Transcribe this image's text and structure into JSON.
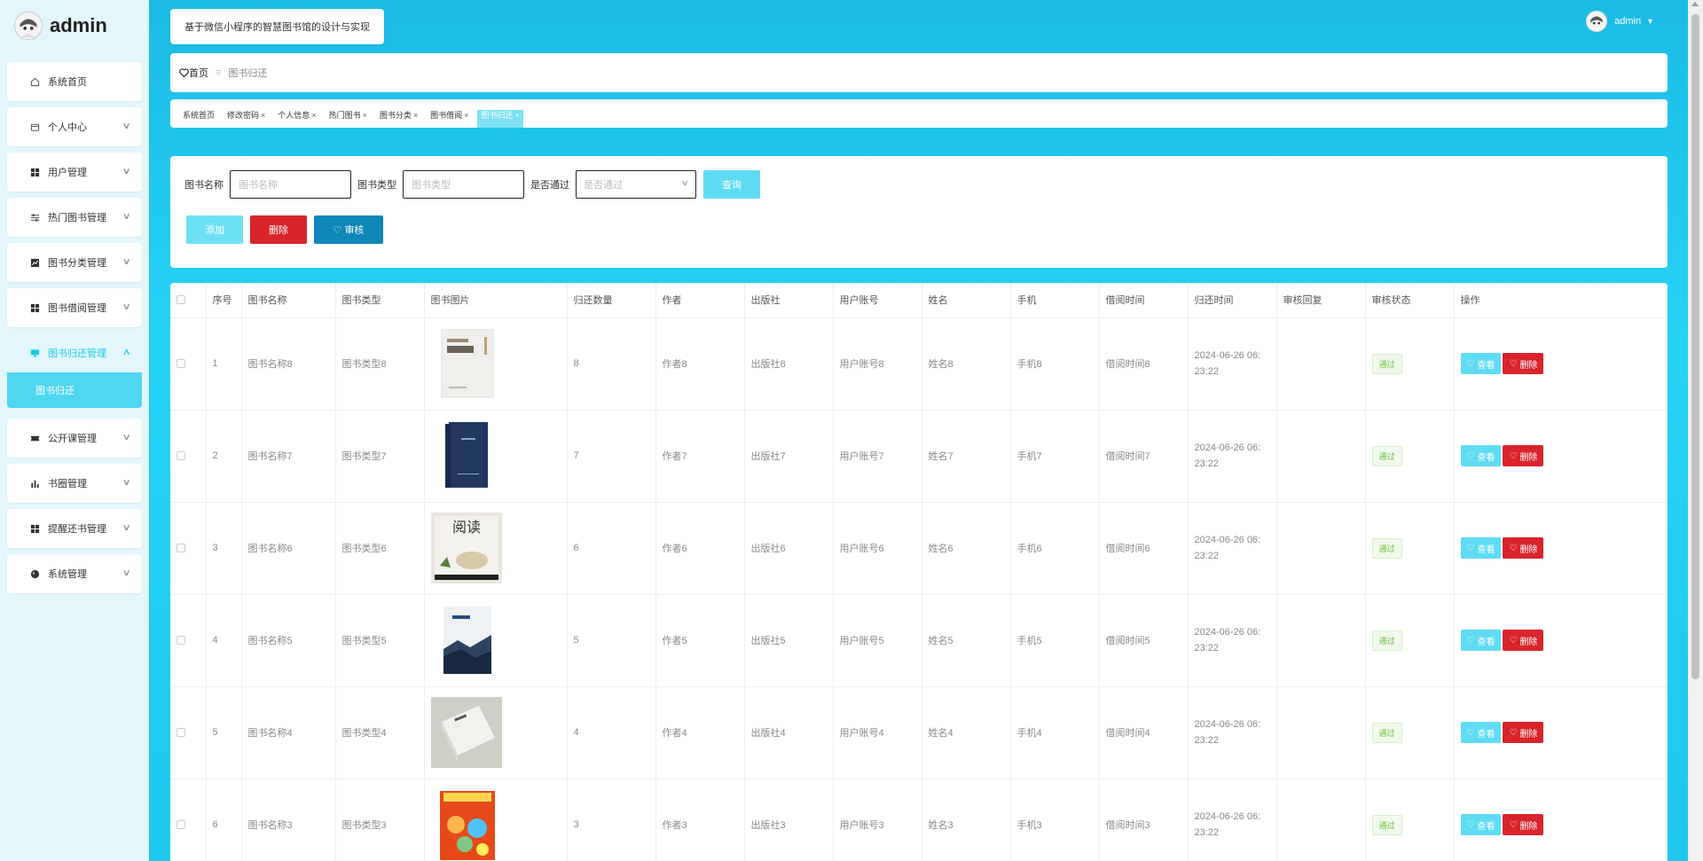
{
  "sidebar": {
    "brand": "admin",
    "items": [
      {
        "label": "系统首页",
        "icon": "home-icon",
        "arrow": false
      },
      {
        "label": "个人中心",
        "icon": "wallet-icon",
        "arrow": true
      },
      {
        "label": "用户管理",
        "icon": "grid-icon",
        "arrow": true
      },
      {
        "label": "热门图书管理",
        "icon": "sliders-icon",
        "arrow": true
      },
      {
        "label": "图书分类管理",
        "icon": "chart-icon",
        "arrow": true
      },
      {
        "label": "图书借阅管理",
        "icon": "grid-icon",
        "arrow": true
      },
      {
        "label": "图书归还管理",
        "icon": "monitor-icon",
        "arrow": true,
        "active": true
      },
      {
        "label": "公开课管理",
        "icon": "ticket-icon",
        "arrow": true
      },
      {
        "label": "书圈管理",
        "icon": "bar-chart-icon",
        "arrow": true
      },
      {
        "label": "提醒还书管理",
        "icon": "grid-icon",
        "arrow": true
      },
      {
        "label": "系统管理",
        "icon": "globe-icon",
        "arrow": true
      }
    ],
    "submenu": {
      "label": "图书归还"
    }
  },
  "header": {
    "title": "基于微信小程序的智慧图书馆的设计与实现",
    "user": "admin"
  },
  "breadcrumb": {
    "home": "首页",
    "separator": "≡",
    "current": "图书归还"
  },
  "tags": [
    {
      "label": "系统首页",
      "closable": false
    },
    {
      "label": "修改密码",
      "closable": true
    },
    {
      "label": "个人信息",
      "closable": true
    },
    {
      "label": "热门图书",
      "closable": true
    },
    {
      "label": "图书分类",
      "closable": true
    },
    {
      "label": "图书借阅",
      "closable": true
    },
    {
      "label": "图书归还",
      "closable": true,
      "active": true
    }
  ],
  "search": {
    "name_label": "图书名称",
    "name_placeholder": "图书名称",
    "type_label": "图书类型",
    "type_placeholder": "图书类型",
    "pass_label": "是否通过",
    "pass_placeholder": "是否通过",
    "query_button": "查询"
  },
  "actions": {
    "add": "添加",
    "delete": "删除",
    "audit": "审核"
  },
  "table": {
    "columns": [
      "序号",
      "图书名称",
      "图书类型",
      "图书图片",
      "归还数量",
      "作者",
      "出版社",
      "用户账号",
      "姓名",
      "手机",
      "借阅时间",
      "归还时间",
      "审核回复",
      "审核状态",
      "操作"
    ],
    "view_label": "查看",
    "delete_label": "删除",
    "rows": [
      {
        "no": "1",
        "name": "图书名称8",
        "type": "图书类型8",
        "cover": "cover-1",
        "qty": "8",
        "author": "作者8",
        "publisher": "出版社8",
        "account": "用户账号8",
        "realname": "姓名8",
        "phone": "手机8",
        "borrow": "借阅时间8",
        "return1": "2024-06-26 06:",
        "return2": "23:22",
        "reply": "",
        "status": "通过"
      },
      {
        "no": "2",
        "name": "图书名称7",
        "type": "图书类型7",
        "cover": "cover-2",
        "qty": "7",
        "author": "作者7",
        "publisher": "出版社7",
        "account": "用户账号7",
        "realname": "姓名7",
        "phone": "手机7",
        "borrow": "借阅时间7",
        "return1": "2024-06-26 06:",
        "return2": "23:22",
        "reply": "",
        "status": "通过"
      },
      {
        "no": "3",
        "name": "图书名称6",
        "type": "图书类型6",
        "cover": "cover-3",
        "qty": "6",
        "author": "作者6",
        "publisher": "出版社6",
        "account": "用户账号6",
        "realname": "姓名6",
        "phone": "手机6",
        "borrow": "借阅时间6",
        "return1": "2024-06-26 06:",
        "return2": "23:22",
        "reply": "",
        "status": "通过"
      },
      {
        "no": "4",
        "name": "图书名称5",
        "type": "图书类型5",
        "cover": "cover-4",
        "qty": "5",
        "author": "作者5",
        "publisher": "出版社5",
        "account": "用户账号5",
        "realname": "姓名5",
        "phone": "手机5",
        "borrow": "借阅时间5",
        "return1": "2024-06-26 06:",
        "return2": "23:22",
        "reply": "",
        "status": "通过"
      },
      {
        "no": "5",
        "name": "图书名称4",
        "type": "图书类型4",
        "cover": "cover-5",
        "qty": "4",
        "author": "作者4",
        "publisher": "出版社4",
        "account": "用户账号4",
        "realname": "姓名4",
        "phone": "手机4",
        "borrow": "借阅时间4",
        "return1": "2024-06-26 06:",
        "return2": "23:22",
        "reply": "",
        "status": "通过"
      },
      {
        "no": "6",
        "name": "图书名称3",
        "type": "图书类型3",
        "cover": "cover-6",
        "qty": "3",
        "author": "作者3",
        "publisher": "出版社3",
        "account": "用户账号3",
        "realname": "姓名3",
        "phone": "手机3",
        "borrow": "借阅时间3",
        "return1": "2024-06-26 06:",
        "return2": "23:22",
        "reply": "",
        "status": "通过"
      }
    ]
  },
  "colors": {
    "accent": "#21c9e6",
    "primary_light": "#5fdcf4",
    "danger": "#d9242c",
    "audit": "#0f87b8",
    "status_green": "#67c23a"
  }
}
